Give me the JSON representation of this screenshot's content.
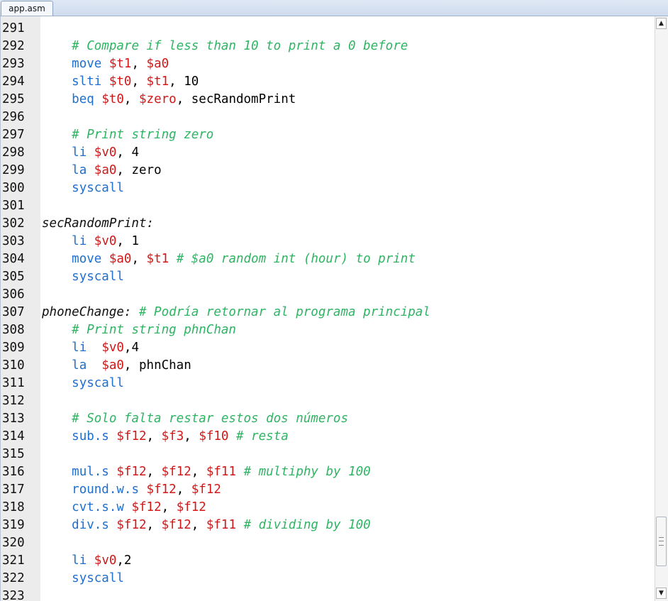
{
  "tab": {
    "label": "app.asm"
  },
  "scrollbar": {
    "up_glyph": "▲",
    "down_glyph": "▼"
  },
  "lines": [
    {
      "n": "291",
      "tokens": []
    },
    {
      "n": "292",
      "tokens": [
        {
          "t": "    ",
          "c": "plain"
        },
        {
          "t": "# Compare if less than 10 to print a 0 before",
          "c": "cmt"
        }
      ]
    },
    {
      "n": "293",
      "tokens": [
        {
          "t": "    ",
          "c": "plain"
        },
        {
          "t": "move",
          "c": "ins"
        },
        {
          "t": " ",
          "c": "plain"
        },
        {
          "t": "$t1",
          "c": "reg"
        },
        {
          "t": ", ",
          "c": "plain"
        },
        {
          "t": "$a0",
          "c": "reg"
        }
      ]
    },
    {
      "n": "294",
      "tokens": [
        {
          "t": "    ",
          "c": "plain"
        },
        {
          "t": "slti",
          "c": "ins"
        },
        {
          "t": " ",
          "c": "plain"
        },
        {
          "t": "$t0",
          "c": "reg"
        },
        {
          "t": ", ",
          "c": "plain"
        },
        {
          "t": "$t1",
          "c": "reg"
        },
        {
          "t": ", 10",
          "c": "plain"
        }
      ]
    },
    {
      "n": "295",
      "tokens": [
        {
          "t": "    ",
          "c": "plain"
        },
        {
          "t": "beq",
          "c": "ins"
        },
        {
          "t": " ",
          "c": "plain"
        },
        {
          "t": "$t0",
          "c": "reg"
        },
        {
          "t": ", ",
          "c": "plain"
        },
        {
          "t": "$zero",
          "c": "reg"
        },
        {
          "t": ", secRandomPrint",
          "c": "plain"
        }
      ]
    },
    {
      "n": "296",
      "tokens": []
    },
    {
      "n": "297",
      "tokens": [
        {
          "t": "    ",
          "c": "plain"
        },
        {
          "t": "# Print string zero",
          "c": "cmt"
        }
      ]
    },
    {
      "n": "298",
      "tokens": [
        {
          "t": "    ",
          "c": "plain"
        },
        {
          "t": "li",
          "c": "ins"
        },
        {
          "t": " ",
          "c": "plain"
        },
        {
          "t": "$v0",
          "c": "reg"
        },
        {
          "t": ", 4",
          "c": "plain"
        }
      ]
    },
    {
      "n": "299",
      "tokens": [
        {
          "t": "    ",
          "c": "plain"
        },
        {
          "t": "la",
          "c": "ins"
        },
        {
          "t": " ",
          "c": "plain"
        },
        {
          "t": "$a0",
          "c": "reg"
        },
        {
          "t": ", zero",
          "c": "plain"
        }
      ]
    },
    {
      "n": "300",
      "tokens": [
        {
          "t": "    ",
          "c": "plain"
        },
        {
          "t": "syscall",
          "c": "ins"
        }
      ]
    },
    {
      "n": "301",
      "tokens": []
    },
    {
      "n": "302",
      "tokens": [
        {
          "t": "secRandomPrint:",
          "c": "lbl"
        }
      ]
    },
    {
      "n": "303",
      "tokens": [
        {
          "t": "    ",
          "c": "plain"
        },
        {
          "t": "li",
          "c": "ins"
        },
        {
          "t": " ",
          "c": "plain"
        },
        {
          "t": "$v0",
          "c": "reg"
        },
        {
          "t": ", 1",
          "c": "plain"
        }
      ]
    },
    {
      "n": "304",
      "tokens": [
        {
          "t": "    ",
          "c": "plain"
        },
        {
          "t": "move",
          "c": "ins"
        },
        {
          "t": " ",
          "c": "plain"
        },
        {
          "t": "$a0",
          "c": "reg"
        },
        {
          "t": ", ",
          "c": "plain"
        },
        {
          "t": "$t1",
          "c": "reg"
        },
        {
          "t": " ",
          "c": "plain"
        },
        {
          "t": "# $a0 random int (hour) to print",
          "c": "cmt"
        }
      ]
    },
    {
      "n": "305",
      "tokens": [
        {
          "t": "    ",
          "c": "plain"
        },
        {
          "t": "syscall",
          "c": "ins"
        }
      ]
    },
    {
      "n": "306",
      "tokens": []
    },
    {
      "n": "307",
      "tokens": [
        {
          "t": "phoneChange:",
          "c": "lbl"
        },
        {
          "t": " ",
          "c": "plain"
        },
        {
          "t": "# Podría retornar al programa principal",
          "c": "cmt"
        }
      ]
    },
    {
      "n": "308",
      "tokens": [
        {
          "t": "    ",
          "c": "plain"
        },
        {
          "t": "# Print string phnChan",
          "c": "cmt"
        }
      ]
    },
    {
      "n": "309",
      "tokens": [
        {
          "t": "    ",
          "c": "plain"
        },
        {
          "t": "li",
          "c": "ins"
        },
        {
          "t": "  ",
          "c": "plain"
        },
        {
          "t": "$v0",
          "c": "reg"
        },
        {
          "t": ",4",
          "c": "plain"
        }
      ]
    },
    {
      "n": "310",
      "tokens": [
        {
          "t": "    ",
          "c": "plain"
        },
        {
          "t": "la",
          "c": "ins"
        },
        {
          "t": "  ",
          "c": "plain"
        },
        {
          "t": "$a0",
          "c": "reg"
        },
        {
          "t": ", phnChan",
          "c": "plain"
        }
      ]
    },
    {
      "n": "311",
      "tokens": [
        {
          "t": "    ",
          "c": "plain"
        },
        {
          "t": "syscall",
          "c": "ins"
        }
      ]
    },
    {
      "n": "312",
      "tokens": []
    },
    {
      "n": "313",
      "tokens": [
        {
          "t": "    ",
          "c": "plain"
        },
        {
          "t": "# Solo falta restar estos dos números",
          "c": "cmt"
        }
      ]
    },
    {
      "n": "314",
      "tokens": [
        {
          "t": "    ",
          "c": "plain"
        },
        {
          "t": "sub.s",
          "c": "ins"
        },
        {
          "t": " ",
          "c": "plain"
        },
        {
          "t": "$f12",
          "c": "reg"
        },
        {
          "t": ", ",
          "c": "plain"
        },
        {
          "t": "$f3",
          "c": "reg"
        },
        {
          "t": ", ",
          "c": "plain"
        },
        {
          "t": "$f10",
          "c": "reg"
        },
        {
          "t": " ",
          "c": "plain"
        },
        {
          "t": "# resta",
          "c": "cmt"
        }
      ]
    },
    {
      "n": "315",
      "tokens": []
    },
    {
      "n": "316",
      "tokens": [
        {
          "t": "    ",
          "c": "plain"
        },
        {
          "t": "mul.s",
          "c": "ins"
        },
        {
          "t": " ",
          "c": "plain"
        },
        {
          "t": "$f12",
          "c": "reg"
        },
        {
          "t": ", ",
          "c": "plain"
        },
        {
          "t": "$f12",
          "c": "reg"
        },
        {
          "t": ", ",
          "c": "plain"
        },
        {
          "t": "$f11",
          "c": "reg"
        },
        {
          "t": " ",
          "c": "plain"
        },
        {
          "t": "# multiphy by 100",
          "c": "cmt"
        }
      ]
    },
    {
      "n": "317",
      "tokens": [
        {
          "t": "    ",
          "c": "plain"
        },
        {
          "t": "round.w.s",
          "c": "ins"
        },
        {
          "t": " ",
          "c": "plain"
        },
        {
          "t": "$f12",
          "c": "reg"
        },
        {
          "t": ", ",
          "c": "plain"
        },
        {
          "t": "$f12",
          "c": "reg"
        }
      ]
    },
    {
      "n": "318",
      "tokens": [
        {
          "t": "    ",
          "c": "plain"
        },
        {
          "t": "cvt.s.w",
          "c": "ins"
        },
        {
          "t": " ",
          "c": "plain"
        },
        {
          "t": "$f12",
          "c": "reg"
        },
        {
          "t": ", ",
          "c": "plain"
        },
        {
          "t": "$f12",
          "c": "reg"
        }
      ]
    },
    {
      "n": "319",
      "tokens": [
        {
          "t": "    ",
          "c": "plain"
        },
        {
          "t": "div.s",
          "c": "ins"
        },
        {
          "t": " ",
          "c": "plain"
        },
        {
          "t": "$f12",
          "c": "reg"
        },
        {
          "t": ", ",
          "c": "plain"
        },
        {
          "t": "$f12",
          "c": "reg"
        },
        {
          "t": ", ",
          "c": "plain"
        },
        {
          "t": "$f11",
          "c": "reg"
        },
        {
          "t": " ",
          "c": "plain"
        },
        {
          "t": "# dividing by 100",
          "c": "cmt"
        }
      ]
    },
    {
      "n": "320",
      "tokens": []
    },
    {
      "n": "321",
      "tokens": [
        {
          "t": "    ",
          "c": "plain"
        },
        {
          "t": "li",
          "c": "ins"
        },
        {
          "t": " ",
          "c": "plain"
        },
        {
          "t": "$v0",
          "c": "reg"
        },
        {
          "t": ",2",
          "c": "plain"
        }
      ]
    },
    {
      "n": "322",
      "tokens": [
        {
          "t": "    ",
          "c": "plain"
        },
        {
          "t": "syscall",
          "c": "ins"
        }
      ]
    },
    {
      "n": "323",
      "tokens": []
    }
  ]
}
